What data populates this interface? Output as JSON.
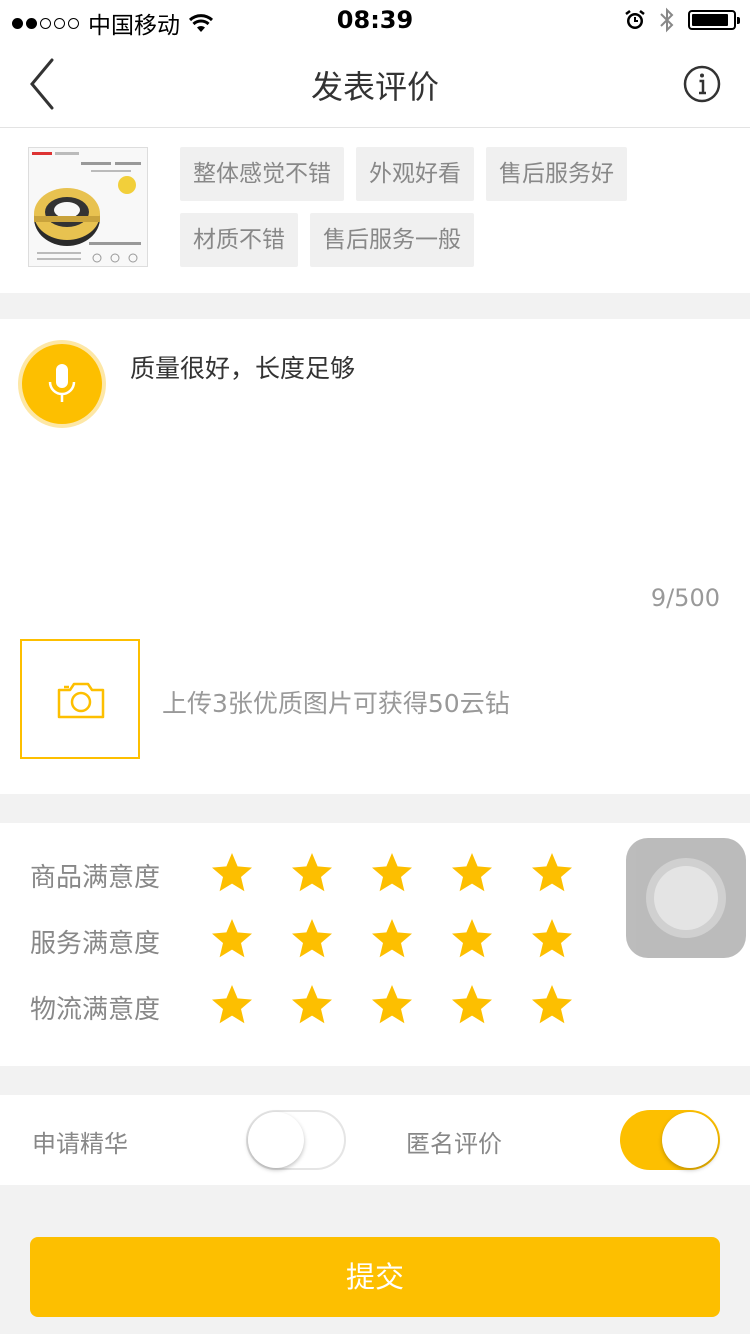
{
  "status_bar": {
    "carrier": "中国移动",
    "time": "08:39",
    "signal_bars_filled": 2,
    "signal_bars_total": 5,
    "battery_level": 0.9
  },
  "nav": {
    "title": "发表评价",
    "back_icon": "chevron-left-icon",
    "info_icon": "info-icon"
  },
  "product": {
    "tags": [
      "整体感觉不错",
      "外观好看",
      "售后服务好",
      "材质不错",
      "售后服务一般"
    ]
  },
  "comment": {
    "text": "质量很好，长度足够",
    "char_count": "9/500",
    "upload_hint": "上传3张优质图片可获得50云钻"
  },
  "ratings": [
    {
      "label": "商品满意度",
      "stars": 5,
      "max": 5
    },
    {
      "label": "服务满意度",
      "stars": 5,
      "max": 5
    },
    {
      "label": "物流满意度",
      "stars": 5,
      "max": 5
    }
  ],
  "toggles": {
    "essence_label": "申请精华",
    "essence_on": false,
    "anonymous_label": "匿名评价",
    "anonymous_on": true
  },
  "submit_label": "提交",
  "colors": {
    "accent": "#fdbf00",
    "background": "#f2f2f2",
    "muted_text": "#888888"
  }
}
